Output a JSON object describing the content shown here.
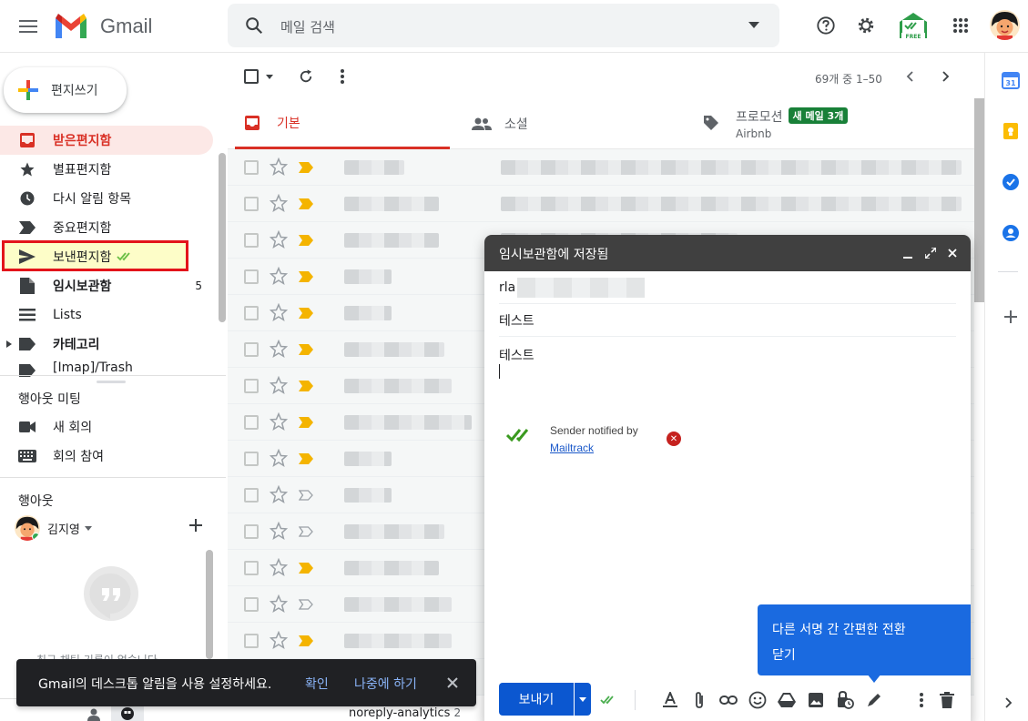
{
  "app": {
    "name": "Gmail",
    "brand_colors": {
      "red": "#ea4335",
      "blue": "#4285f4",
      "green": "#34a853",
      "yellow": "#fbbc04"
    }
  },
  "search": {
    "placeholder": "메일 검색"
  },
  "compose_button": {
    "label": "편지쓰기"
  },
  "sidebar": {
    "items": [
      {
        "label": "받은편지함",
        "icon": "inbox-icon",
        "active": true
      },
      {
        "label": "별표편지함",
        "icon": "star-icon"
      },
      {
        "label": "다시 알림 항목",
        "icon": "clock-icon"
      },
      {
        "label": "중요편지함",
        "icon": "important-icon"
      },
      {
        "label": "보낸편지함",
        "icon": "send-icon",
        "highlighted": true
      },
      {
        "label": "임시보관함",
        "icon": "draft-icon",
        "count": "5",
        "bold": true
      },
      {
        "label": "Lists",
        "icon": "list-icon"
      },
      {
        "label": "카테고리",
        "icon": "label-icon",
        "bold": true
      },
      {
        "label": "[Imap]/Trash",
        "icon": "label-icon"
      }
    ]
  },
  "meet": {
    "title": "행아웃 미팅",
    "items": [
      {
        "label": "새 회의",
        "icon": "video-icon"
      },
      {
        "label": "회의 참여",
        "icon": "keyboard-icon"
      }
    ]
  },
  "hangouts": {
    "title": "행아웃",
    "user": "김지영",
    "empty_text": "최근 채팅 기록이 없습니다"
  },
  "list": {
    "pager": "69개 중 1–50",
    "tabs": [
      {
        "label": "기본",
        "active": true
      },
      {
        "label": "소셜"
      },
      {
        "label": "프로모션",
        "badge": "새 메일 3개",
        "sub": "Airbnb"
      }
    ],
    "bottom_sender": "noreply-analytics",
    "bottom_count": "2"
  },
  "compose_window": {
    "title": "임시보관함에 저장됨",
    "to_prefix": "rla",
    "subject": "테스트",
    "body": "테스트",
    "mailtrack_line1": "Sender notified by",
    "mailtrack_link": "Mailtrack",
    "tip_line1": "다른 서명 간 간편한 전환",
    "tip_line2": "닫기",
    "send_label": "보내기"
  },
  "snackbar": {
    "message": "Gmail의 데스크톱 알림을 사용 설정하세요.",
    "confirm": "확인",
    "later": "나중에 하기"
  }
}
